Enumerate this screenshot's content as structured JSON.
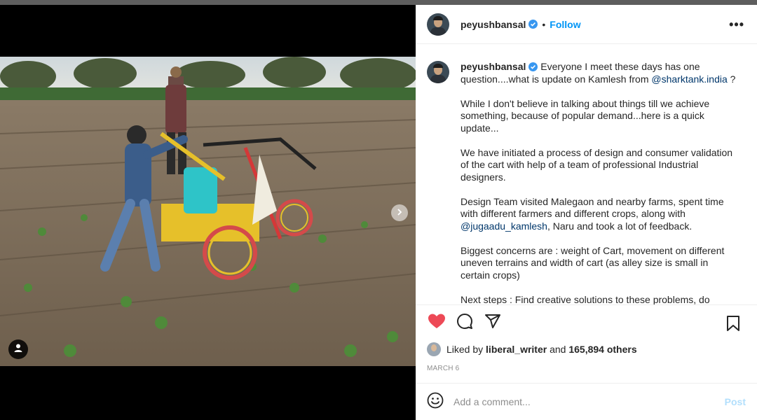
{
  "post": {
    "username": "peyushbansal",
    "follow_label": "Follow",
    "dot": "•",
    "more_label": "•••",
    "caption_paragraphs": [
      {
        "before": "Everyone I meet these days has one question....what is update on Kamlesh from ",
        "mention": "@sharktank.india",
        "after": " ?"
      },
      {
        "before": "While I don't believe in talking about things till we achieve something, because of popular demand...here is a quick update...",
        "mention": "",
        "after": ""
      },
      {
        "before": "We have initiated a process of design and consumer validation of the cart with help of a team of professional Industrial designers.",
        "mention": "",
        "after": ""
      },
      {
        "before": "Design Team visited Malegaon and nearby farms, spent time with different farmers and different crops, along with ",
        "mention": "@jugaadu_kamlesh",
        "after": ", Naru and took a lot of feedback."
      },
      {
        "before": "Biggest concerns are : weight of Cart, movement on different uneven terrains and width of cart (as alley size is small in certain crops)",
        "mention": "",
        "after": ""
      },
      {
        "before": "Next steps : Find creative solutions to these problems, do design optimisations and go back and test again.",
        "mention": "",
        "after": ""
      }
    ],
    "liked_prefix": "Liked by",
    "liked_by": "liberal_writer",
    "liked_and": "and",
    "likes_count": "165,894 others",
    "date": "MARCH 6",
    "comment_placeholder": "Add a comment...",
    "post_label": "Post",
    "liked": true
  },
  "icons": {
    "heart": "heart-icon",
    "comment": "comment-icon",
    "share": "share-icon",
    "save": "bookmark-icon",
    "emoji": "emoji-icon",
    "tag": "user-tag-icon",
    "next": "chevron-right-icon",
    "verified": "verified-badge-icon"
  },
  "colors": {
    "accent": "#0095f6",
    "like": "#ed4956",
    "mention": "#00376b",
    "post_disabled": "#b2dffc"
  }
}
